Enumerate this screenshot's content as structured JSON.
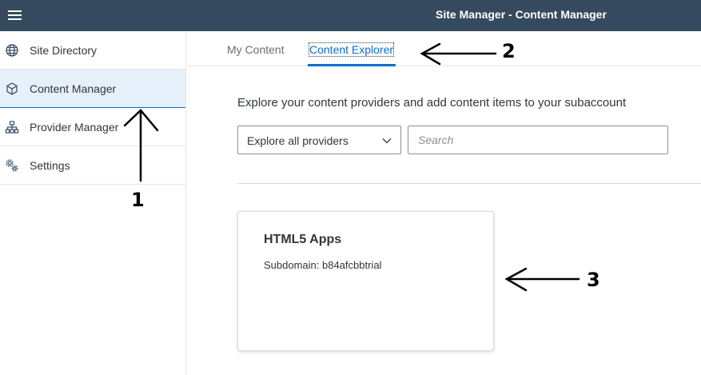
{
  "shell": {
    "title": "Site Manager - Content Manager",
    "menu_icon": "hamburger-menu-icon",
    "bg_color": "#354a5f"
  },
  "sidebar": {
    "items": [
      {
        "label": "Site Directory",
        "icon": "globe-icon",
        "selected": false
      },
      {
        "label": "Content Manager",
        "icon": "cube-icon",
        "selected": true
      },
      {
        "label": "Provider Manager",
        "icon": "hierarchy-icon",
        "selected": false
      },
      {
        "label": "Settings",
        "icon": "gears-icon",
        "selected": false
      }
    ]
  },
  "tabs": [
    {
      "label": "My Content",
      "selected": false
    },
    {
      "label": "Content Explorer",
      "selected": true
    }
  ],
  "main": {
    "description": "Explore your content providers and add content items to your subaccount",
    "provider_select": {
      "value": "Explore all providers"
    },
    "search": {
      "placeholder": "Search",
      "value": ""
    },
    "tile": {
      "title": "HTML5 Apps",
      "subdomain": "Subdomain: b84afcbbtrial"
    }
  },
  "annotations": {
    "n1": "1",
    "n2": "2",
    "n3": "3"
  },
  "colors": {
    "accent": "#0a6ed1",
    "selected_bg": "#e5f0fa"
  }
}
